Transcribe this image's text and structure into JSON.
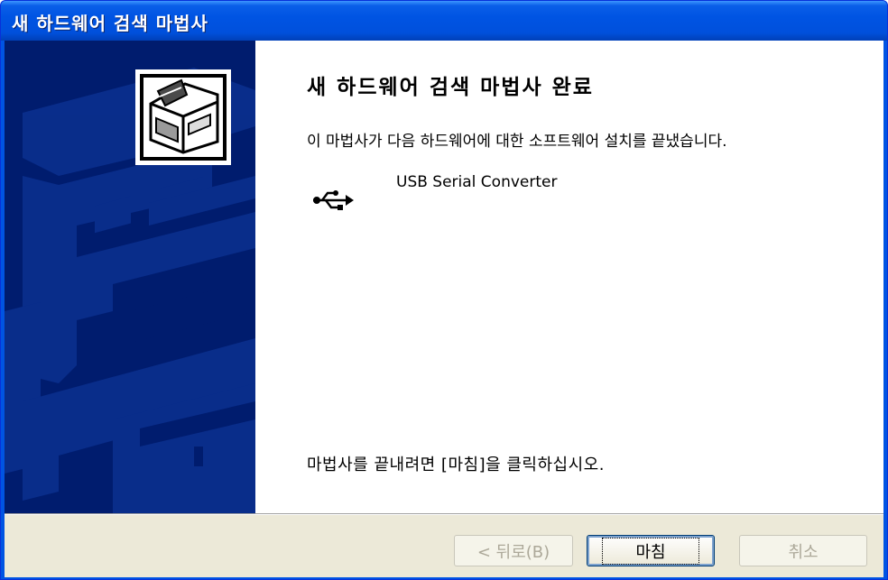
{
  "window": {
    "title": "새 하드웨어 검색 마법사"
  },
  "side_panel": {
    "icon": "hardware-box-icon",
    "colors": {
      "background": "#001c6e",
      "pattern": "#0a2e8c"
    }
  },
  "content": {
    "heading": "새 하드웨어 검색 마법사 완료",
    "description": "이 마법사가 다음 하드웨어에 대한 소프트웨어 설치를 끝냈습니다.",
    "device": {
      "icon": "usb-icon",
      "name": "USB Serial Converter"
    },
    "instruction": "마법사를 끝내려면 [마침]을 클릭하십시오."
  },
  "buttons": {
    "back": "< 뒤로(B)",
    "finish": "마침",
    "cancel": "취소"
  },
  "colors": {
    "titlebar": "#0054e3",
    "footer": "#ece9d8",
    "disabled_text": "#aca899"
  }
}
